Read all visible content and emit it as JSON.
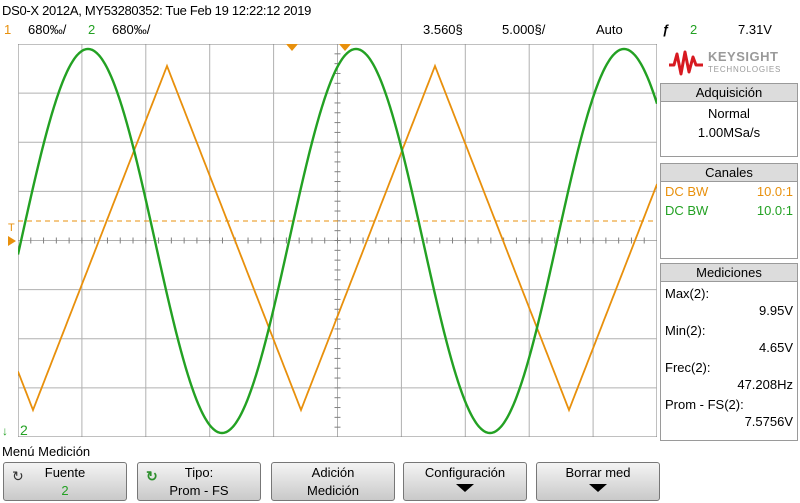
{
  "header": {
    "model_line": "DS0-X 2012A, MY53280352: Tue Feb 19 12:22:12 2019",
    "ch1_num": "1",
    "ch1_scale": "680‰/",
    "ch2_num": "2",
    "ch2_scale": "680‰/",
    "time_offset": "3.560§",
    "time_scale": "5.000§/",
    "trigger_mode": "Auto",
    "trigger_slope": "ƒ",
    "trigger_source": "2",
    "trigger_level": "7.31V"
  },
  "logo": {
    "brand": "KEYSIGHT",
    "sub": "TECHNOLOGIES"
  },
  "acquisition": {
    "title": "Adquisición",
    "mode": "Normal",
    "rate": "1.00MSa/s"
  },
  "channels": {
    "title": "Canales",
    "rows": [
      {
        "coupling": "DC BW",
        "probe": "10.0:1"
      },
      {
        "coupling": "DC BW",
        "probe": "10.0:1"
      }
    ]
  },
  "measurements": {
    "title": "Mediciones",
    "items": [
      {
        "label": "Max(2):",
        "value": "9.95V"
      },
      {
        "label": "Min(2):",
        "value": "4.65V"
      },
      {
        "label": "Frec(2):",
        "value": "47.208Hz"
      },
      {
        "label": "Prom - FS(2):",
        "value": "7.5756V"
      }
    ]
  },
  "plot": {
    "trigger_marker": "T",
    "ch2_ground_label": "2"
  },
  "menu": {
    "title": "Menú Medición",
    "keys": [
      {
        "l1": "Fuente",
        "l2": "2"
      },
      {
        "l1": "Tipo:",
        "l2": "Prom - FS"
      },
      {
        "l1": "Adición",
        "l2": "Medición"
      },
      {
        "l1": "Configuración",
        "l2": ""
      },
      {
        "l1": "Borrar med",
        "l2": ""
      }
    ]
  },
  "colors": {
    "ch1": "#e8900c",
    "ch2": "#23a123",
    "grid": "#b0b0b0"
  }
}
